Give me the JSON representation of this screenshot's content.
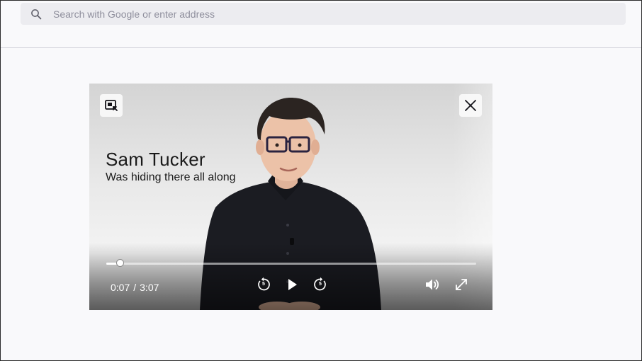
{
  "urlbar": {
    "placeholder": "Search with Google or enter address",
    "icon": "search-icon"
  },
  "pip": {
    "lower_third": {
      "name": "Sam Tucker",
      "tagline": "Was hiding there all along"
    },
    "current_time": "0:07",
    "separator": "/",
    "duration": "3:07",
    "progress": 0.037,
    "skip_seconds_back": "5",
    "skip_seconds_forward": "5",
    "icons": {
      "toggle": "pip-toggle-icon",
      "close": "close-icon",
      "rewind": "rewind-5-icon",
      "play": "play-icon",
      "forward": "forward-5-icon",
      "volume": "volume-icon",
      "fullscreen": "fullscreen-icon"
    }
  }
}
